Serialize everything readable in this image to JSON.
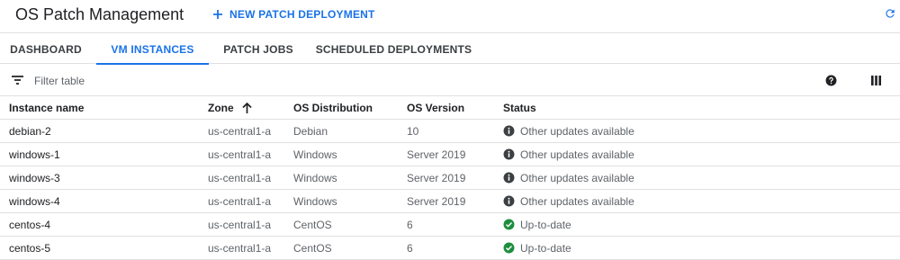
{
  "header": {
    "title": "OS Patch Management",
    "new_deployment_label": "NEW PATCH DEPLOYMENT",
    "refresh_icon": "refresh-icon",
    "accent_color": "#1a73e8"
  },
  "tabs": [
    {
      "label": "DASHBOARD",
      "active": false
    },
    {
      "label": "VM INSTANCES",
      "active": true
    },
    {
      "label": "PATCH JOBS",
      "active": false
    },
    {
      "label": "SCHEDULED DEPLOYMENTS",
      "active": false
    }
  ],
  "filter": {
    "placeholder": "Filter table",
    "filter_icon": "filter-list-icon",
    "help_icon": "help-icon",
    "columns_icon": "column-display-icon"
  },
  "table": {
    "columns": [
      "Instance name",
      "Zone",
      "OS Distribution",
      "OS Version",
      "Status"
    ],
    "sorted_column": "Zone",
    "sort_direction": "ascending",
    "rows": [
      {
        "name": "debian-2",
        "zone": "us-central1-a",
        "distribution": "Debian",
        "version": "10",
        "status": "Other updates available",
        "status_icon": "info-icon"
      },
      {
        "name": "windows-1",
        "zone": "us-central1-a",
        "distribution": "Windows",
        "version": "Server 2019",
        "status": "Other updates available",
        "status_icon": "info-icon"
      },
      {
        "name": "windows-3",
        "zone": "us-central1-a",
        "distribution": "Windows",
        "version": "Server 2019",
        "status": "Other updates available",
        "status_icon": "info-icon"
      },
      {
        "name": "windows-4",
        "zone": "us-central1-a",
        "distribution": "Windows",
        "version": "Server 2019",
        "status": "Other updates available",
        "status_icon": "info-icon"
      },
      {
        "name": "centos-4",
        "zone": "us-central1-a",
        "distribution": "CentOS",
        "version": "6",
        "status": "Up-to-date",
        "status_icon": "check-circle-icon"
      },
      {
        "name": "centos-5",
        "zone": "us-central1-a",
        "distribution": "CentOS",
        "version": "6",
        "status": "Up-to-date",
        "status_icon": "check-circle-icon"
      }
    ]
  },
  "colors": {
    "info": "#3c4043",
    "ok": "#1e8e3e"
  }
}
